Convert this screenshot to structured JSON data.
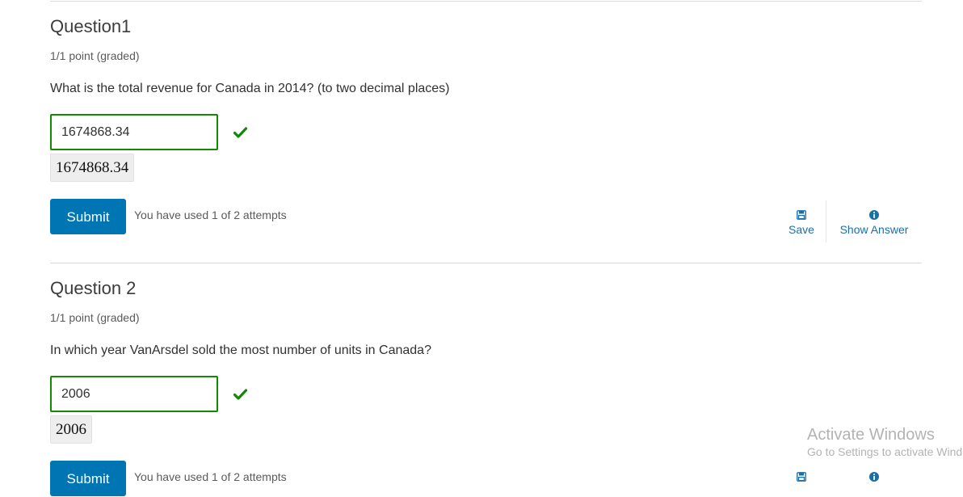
{
  "questions": [
    {
      "title": "Question1",
      "points": "1/1 point (graded)",
      "prompt": "What is the total revenue for Canada in 2014? (to two decimal places)",
      "answer_value": "1674868.34",
      "preview": "1674868.34",
      "submit_label": "Submit",
      "attempts": "You have used 1 of 2 attempts",
      "save_label": "Save",
      "show_answer_label": "Show Answer"
    },
    {
      "title": "Question 2",
      "points": "1/1 point (graded)",
      "prompt": "In which year VanArsdel sold the most number of units in Canada?",
      "answer_value": "2006",
      "preview": "2006",
      "submit_label": "Submit",
      "attempts": "You have used 1 of 2 attempts"
    }
  ],
  "watermark": {
    "title": "Activate Windows",
    "subtitle": "Go to Settings to activate Windows."
  },
  "colors": {
    "correct": "#108a00",
    "primary": "#0075b4",
    "link": "#1a6fa8"
  },
  "icons": {
    "correct": "check-icon",
    "save": "save-icon",
    "show_answer": "info-icon"
  }
}
